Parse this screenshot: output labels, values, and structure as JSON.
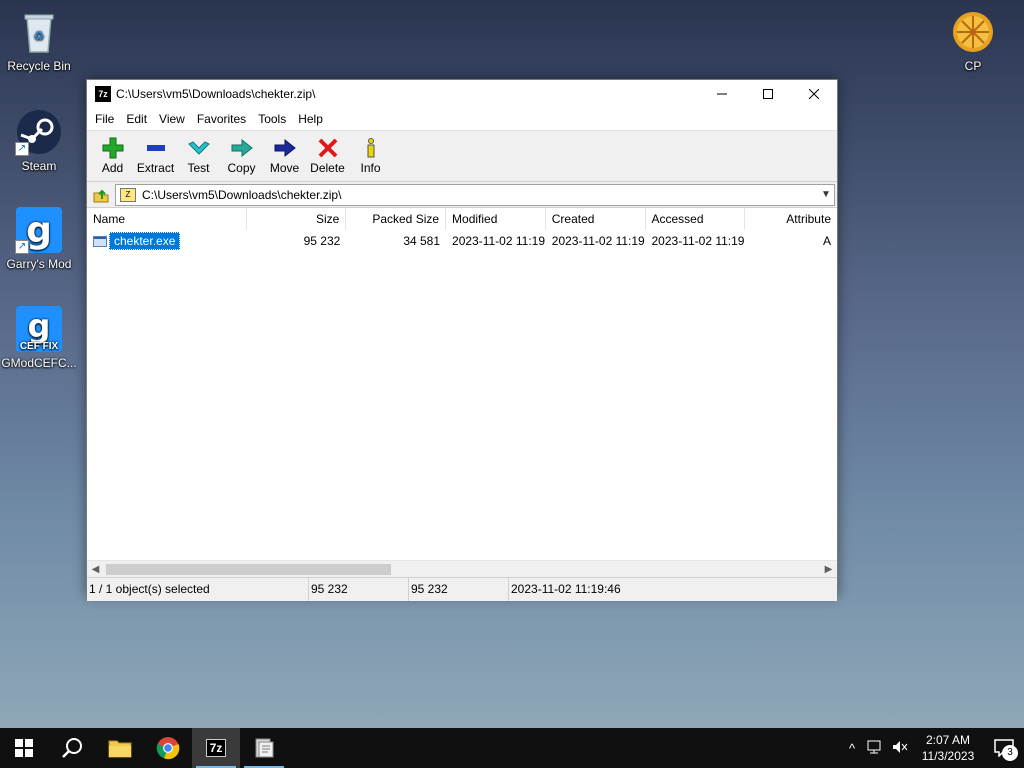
{
  "desktop": {
    "icons": [
      {
        "label": "Recycle Bin",
        "icon": "recycle-bin-icon"
      },
      {
        "label": "Steam",
        "icon": "steam-icon"
      },
      {
        "label": "Garry's Mod",
        "icon": "garrys-mod-icon"
      },
      {
        "label": "GModCEFC...",
        "icon": "gmod-cef-fix-icon",
        "overlay": "CEF FIX"
      },
      {
        "label": "CP",
        "icon": "cp-icon"
      }
    ]
  },
  "window": {
    "title": "C:\\Users\\vm5\\Downloads\\chekter.zip\\",
    "app_icon": "7z",
    "menu": [
      "File",
      "Edit",
      "View",
      "Favorites",
      "Tools",
      "Help"
    ],
    "toolbar": [
      {
        "label": "Add",
        "icon": "add-icon",
        "color": "#22a82a"
      },
      {
        "label": "Extract",
        "icon": "extract-icon",
        "color": "#1f3fbf"
      },
      {
        "label": "Test",
        "icon": "test-icon",
        "color": "#25c0c8"
      },
      {
        "label": "Copy",
        "icon": "copy-icon",
        "color": "#2aa89a"
      },
      {
        "label": "Move",
        "icon": "move-icon",
        "color": "#1a2a9a"
      },
      {
        "label": "Delete",
        "icon": "delete-icon",
        "color": "#e01818"
      },
      {
        "label": "Info",
        "icon": "info-icon",
        "color": "#e8d800"
      }
    ],
    "address": "C:\\Users\\vm5\\Downloads\\chekter.zip\\",
    "columns": [
      "Name",
      "Size",
      "Packed Size",
      "Modified",
      "Created",
      "Accessed",
      "Attribute"
    ],
    "rows": [
      {
        "name": "chekter.exe",
        "size": "95 232",
        "packed": "34 581",
        "modified": "2023-11-02 11:19",
        "created": "2023-11-02 11:19",
        "accessed": "2023-11-02 11:19",
        "attr": "A",
        "selected": true
      }
    ],
    "status": {
      "selection": "1 / 1 object(s) selected",
      "size": "95 232",
      "packed": "95 232",
      "modified": "2023-11-02 11:19:46"
    }
  },
  "taskbar": {
    "items": [
      {
        "icon": "windows-start-icon"
      },
      {
        "icon": "search-icon"
      },
      {
        "icon": "file-explorer-icon"
      },
      {
        "icon": "chrome-icon"
      },
      {
        "icon": "seven-zip-icon",
        "label": "7z",
        "active": true
      },
      {
        "icon": "app-icon",
        "open": true
      }
    ],
    "time": "2:07 AM",
    "date": "11/3/2023",
    "notifications": "3"
  }
}
